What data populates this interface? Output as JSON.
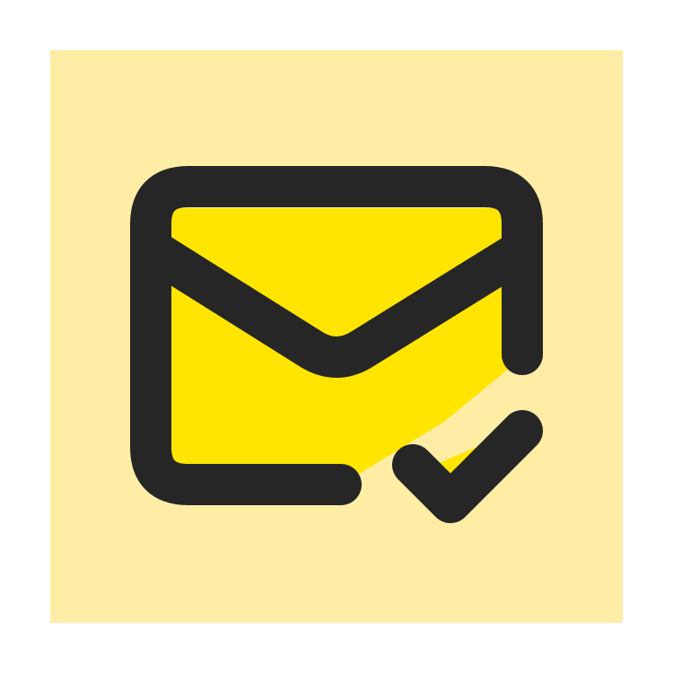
{
  "icon": {
    "name": "mail-check-icon",
    "colors": {
      "background": "#ffffff",
      "tile": "#ffeda5",
      "fill": "#ffe500",
      "stroke": "#262626"
    }
  }
}
